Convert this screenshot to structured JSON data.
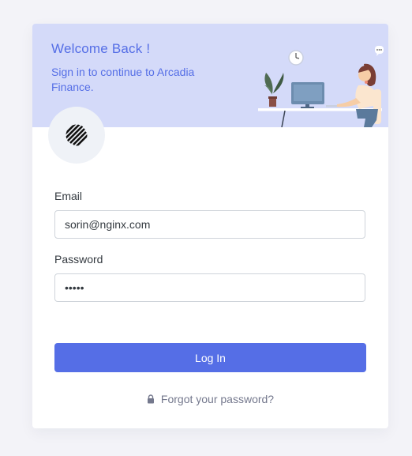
{
  "header": {
    "title": "Welcome Back !",
    "subtitle": "Sign in to continue to Arcadia Finance."
  },
  "form": {
    "email_label": "Email",
    "email_value": "sorin@nginx.com",
    "password_label": "Password",
    "password_value": "•••••",
    "login_label": "Log In",
    "forgot_label": "Forgot your password?"
  },
  "icons": {
    "logo": "striped-circle-logo-icon",
    "lock": "lock-icon",
    "illustration": "woman-at-desk-illustration"
  },
  "colors": {
    "accent": "#556ee6",
    "banner": "#d4daf9",
    "page_background": "#f3f3f8"
  }
}
